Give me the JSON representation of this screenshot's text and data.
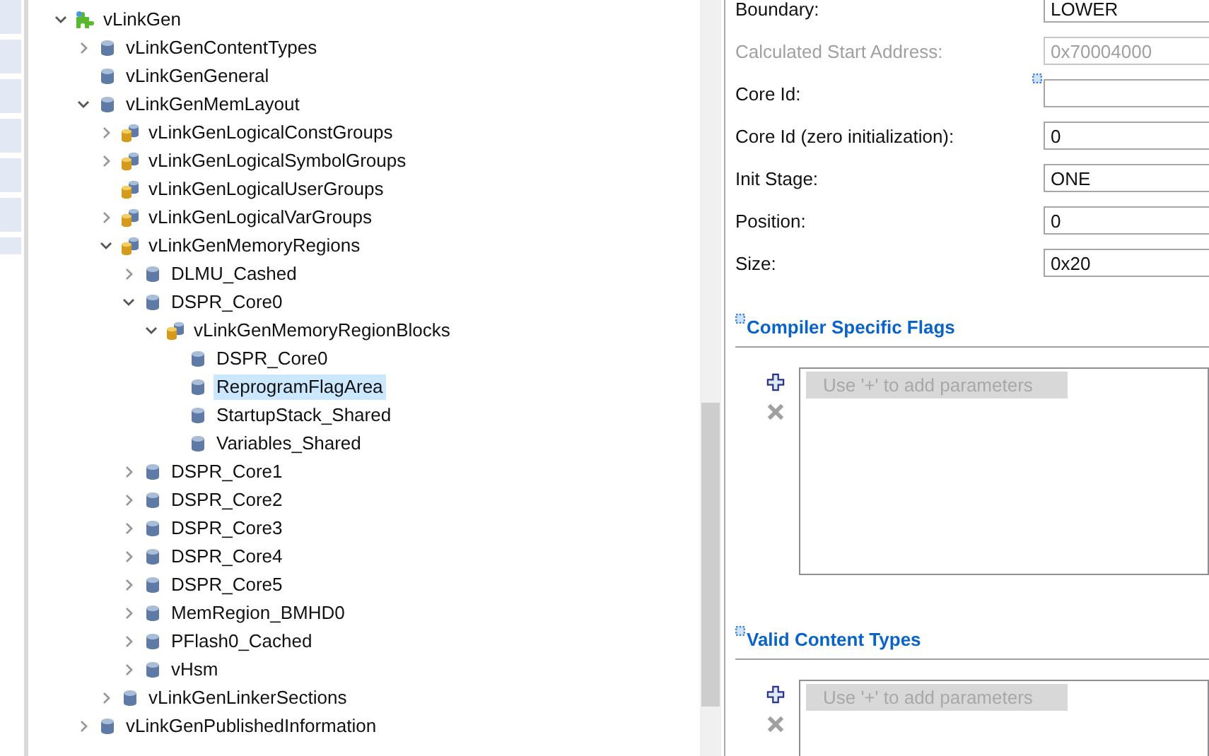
{
  "tree": [
    {
      "label": "vLinkGen",
      "kind": "plugin",
      "expanded": true,
      "selected": false,
      "children": [
        {
          "label": "vLinkGenContentTypes",
          "kind": "container",
          "expanded": false,
          "selected": false
        },
        {
          "label": "vLinkGenGeneral",
          "kind": "container",
          "selected": false
        },
        {
          "label": "vLinkGenMemLayout",
          "kind": "container",
          "expanded": true,
          "selected": false,
          "children": [
            {
              "label": "vLinkGenLogicalConstGroups",
              "kind": "group",
              "expanded": false,
              "selected": false
            },
            {
              "label": "vLinkGenLogicalSymbolGroups",
              "kind": "group",
              "expanded": false,
              "selected": false
            },
            {
              "label": "vLinkGenLogicalUserGroups",
              "kind": "group",
              "selected": false
            },
            {
              "label": "vLinkGenLogicalVarGroups",
              "kind": "group",
              "expanded": false,
              "selected": false
            },
            {
              "label": "vLinkGenMemoryRegions",
              "kind": "group",
              "expanded": true,
              "selected": false,
              "children": [
                {
                  "label": "DLMU_Cashed",
                  "kind": "container",
                  "expanded": false,
                  "selected": false
                },
                {
                  "label": "DSPR_Core0",
                  "kind": "container",
                  "expanded": true,
                  "selected": false,
                  "children": [
                    {
                      "label": "vLinkGenMemoryRegionBlocks",
                      "kind": "group",
                      "expanded": true,
                      "selected": false,
                      "children": [
                        {
                          "label": "DSPR_Core0",
                          "kind": "container",
                          "selected": false
                        },
                        {
                          "label": "ReprogramFlagArea",
                          "kind": "container",
                          "selected": true
                        },
                        {
                          "label": "StartupStack_Shared",
                          "kind": "container",
                          "selected": false
                        },
                        {
                          "label": "Variables_Shared",
                          "kind": "container",
                          "selected": false
                        }
                      ]
                    }
                  ]
                },
                {
                  "label": "DSPR_Core1",
                  "kind": "container",
                  "expanded": false,
                  "selected": false
                },
                {
                  "label": "DSPR_Core2",
                  "kind": "container",
                  "expanded": false,
                  "selected": false
                },
                {
                  "label": "DSPR_Core3",
                  "kind": "container",
                  "expanded": false,
                  "selected": false
                },
                {
                  "label": "DSPR_Core4",
                  "kind": "container",
                  "expanded": false,
                  "selected": false
                },
                {
                  "label": "DSPR_Core5",
                  "kind": "container",
                  "expanded": false,
                  "selected": false
                },
                {
                  "label": "MemRegion_BMHD0",
                  "kind": "container",
                  "expanded": false,
                  "selected": false
                },
                {
                  "label": "PFlash0_Cached",
                  "kind": "container",
                  "expanded": false,
                  "selected": false
                },
                {
                  "label": "vHsm",
                  "kind": "container",
                  "expanded": false,
                  "selected": false
                }
              ]
            },
            {
              "label": "vLinkGenLinkerSections",
              "kind": "container",
              "expanded": false,
              "selected": false
            }
          ]
        },
        {
          "label": "vLinkGenPublishedInformation",
          "kind": "container",
          "expanded": false,
          "selected": false
        }
      ]
    }
  ],
  "fields": [
    {
      "label": "Boundary:",
      "value": "LOWER",
      "disabled": false
    },
    {
      "label": "Calculated Start Address:",
      "value": "0x70004000",
      "disabled": true
    },
    {
      "label": "Core Id:",
      "disabled": false,
      "decorated": true
    },
    {
      "label": "Core Id (zero initialization):",
      "value": "0",
      "disabled": false
    },
    {
      "label": "Init Stage:",
      "value": "ONE",
      "disabled": false
    },
    {
      "label": "Position:",
      "value": "0",
      "disabled": false
    },
    {
      "label": "Size:",
      "value": "0x20",
      "disabled": false
    }
  ],
  "sections": [
    {
      "title": "Compiler Specific Flags",
      "placeholder": "Use '+' to add parameters"
    },
    {
      "title": "Valid Content Types",
      "placeholder": "Use '+' to add parameters"
    }
  ]
}
